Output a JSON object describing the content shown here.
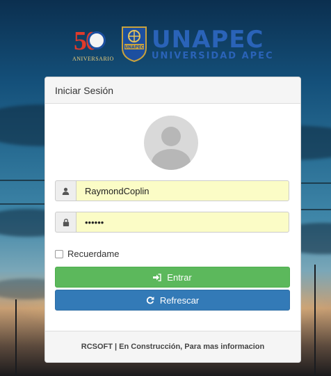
{
  "header": {
    "anniversary_number": "50",
    "anniversary_label": "ANIVERSARIO",
    "shield_text": "UNAPEC",
    "brand_name": "UNAPEC",
    "brand_subtitle": "UNIVERSIDAD APEC"
  },
  "login": {
    "title": "Iniciar Sesión",
    "username_value": "RaymondCoplin",
    "password_value": "••••••",
    "remember_label": "Recuerdame",
    "remember_checked": false,
    "submit_label": "Entrar",
    "refresh_label": "Refrescar",
    "footer_text": "RCSOFT | En Construcción, Para mas informacion"
  },
  "colors": {
    "success": "#5cb85c",
    "primary": "#337ab7",
    "autofill": "#fbfcc6",
    "brand_blue": "#2a63b8",
    "anniversary_red": "#e03a2b"
  },
  "icons": {
    "username": "user-icon",
    "password": "lock-icon",
    "submit": "sign-in-icon",
    "refresh": "refresh-icon"
  }
}
